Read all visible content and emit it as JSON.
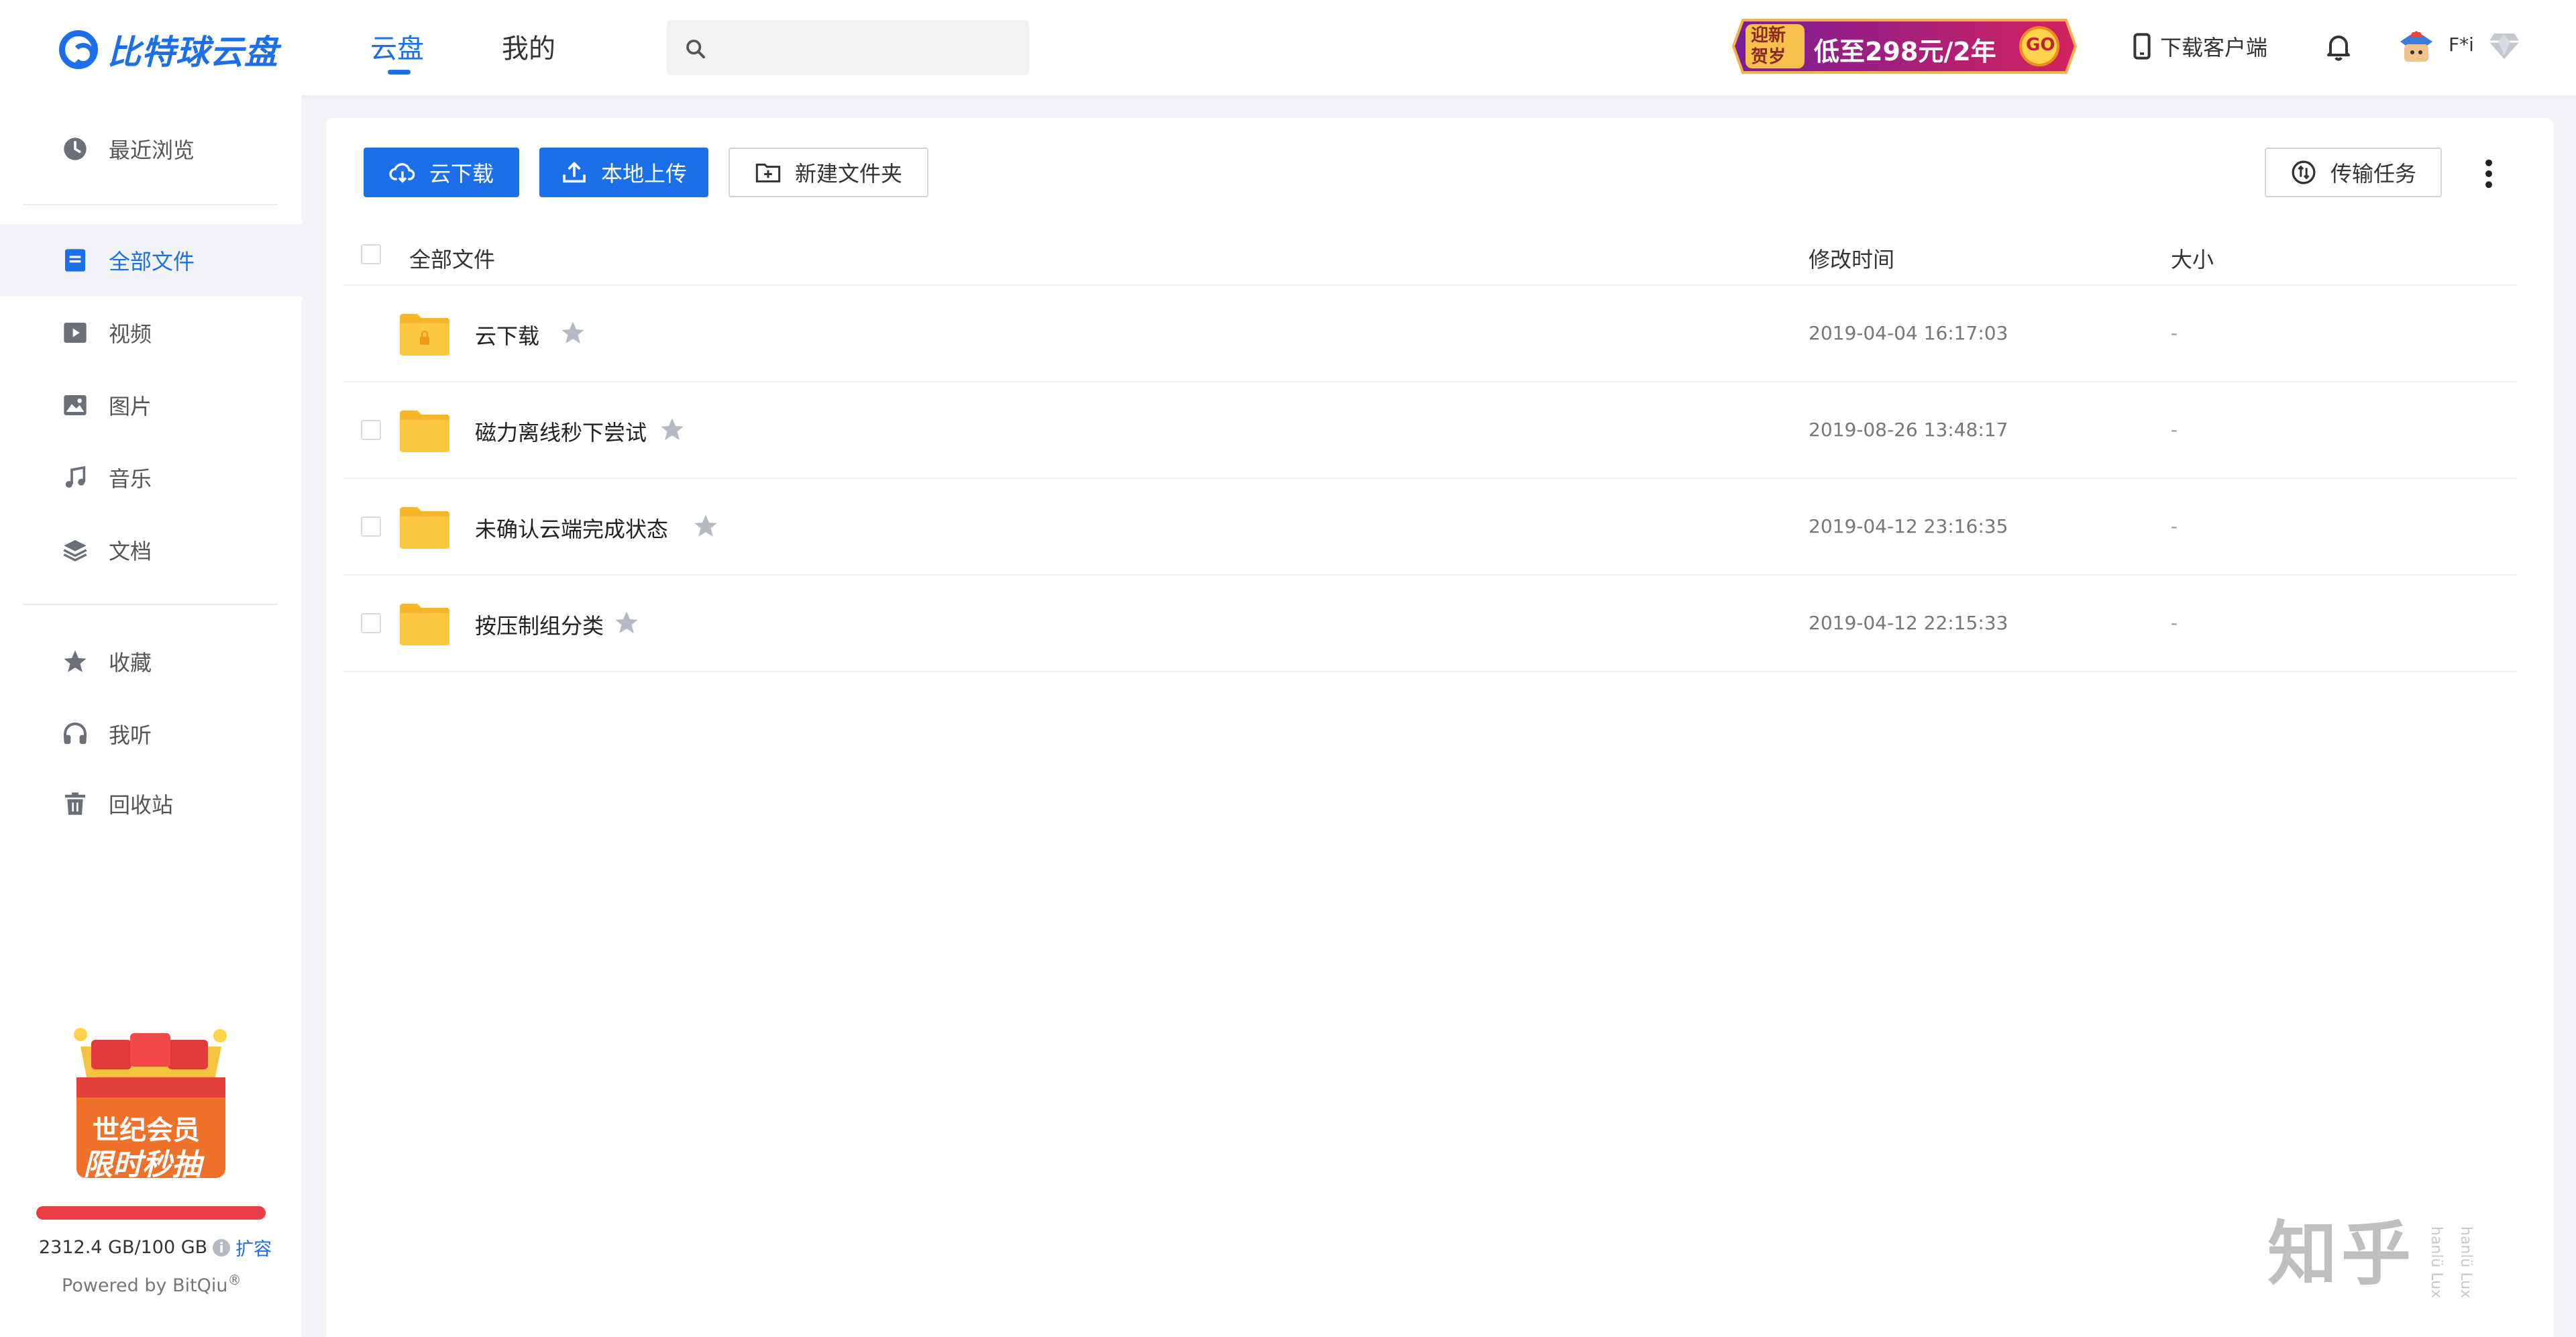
{
  "app": {
    "logo_text": "比特球云盘",
    "brand_color": "#1c6fe8"
  },
  "nav": {
    "tabs": [
      {
        "label": "云盘",
        "active": true
      },
      {
        "label": "我的",
        "active": false
      }
    ]
  },
  "search": {
    "placeholder": ""
  },
  "header": {
    "promo": {
      "badge_line1": "迎新",
      "badge_line2": "贺岁",
      "text": "低至298元/2年",
      "go": "GO"
    },
    "download_client": "下载客户端",
    "username": "F*i"
  },
  "sidebar": {
    "items": [
      {
        "label": "最近浏览",
        "icon": "clock-icon"
      },
      {
        "label": "全部文件",
        "icon": "document-icon",
        "active": true
      },
      {
        "label": "视频",
        "icon": "video-icon"
      },
      {
        "label": "图片",
        "icon": "image-icon"
      },
      {
        "label": "音乐",
        "icon": "music-note-icon"
      },
      {
        "label": "文档",
        "icon": "layers-icon"
      },
      {
        "label": "收藏",
        "icon": "star-icon"
      },
      {
        "label": "我听",
        "icon": "headphones-icon"
      },
      {
        "label": "回收站",
        "icon": "trash-icon"
      }
    ],
    "member_promo": {
      "line1": "世纪会员",
      "line2": "限时秒抽"
    },
    "storage": {
      "used_text": "2312.4 GB/100 GB",
      "usage_fraction": 1.0,
      "expand": "扩容",
      "bar_color": "#eb3d45"
    },
    "powered": "Powered by BitQiu"
  },
  "toolbar": {
    "cloud_download": "云下载",
    "local_upload": "本地上传",
    "new_folder": "新建文件夹",
    "transfer_tasks": "传输任务"
  },
  "table": {
    "columns": [
      "全部文件",
      "修改时间",
      "大小"
    ],
    "rows": [
      {
        "name": "云下载",
        "modified": "2019-04-04 16:17:03",
        "size": "-",
        "locked": true
      },
      {
        "name": "磁力离线秒下尝试",
        "modified": "2019-08-26 13:48:17",
        "size": "-",
        "locked": false
      },
      {
        "name": "未确认云端完成状态",
        "modified": "2019-04-12 23:16:35",
        "size": "-",
        "locked": false
      },
      {
        "name": "按压制组分类",
        "modified": "2019-04-12 22:15:33",
        "size": "-",
        "locked": false
      }
    ]
  },
  "watermark": {
    "text": "知乎",
    "side1": "hanlü Lux",
    "side2": "hanlü Lux"
  }
}
